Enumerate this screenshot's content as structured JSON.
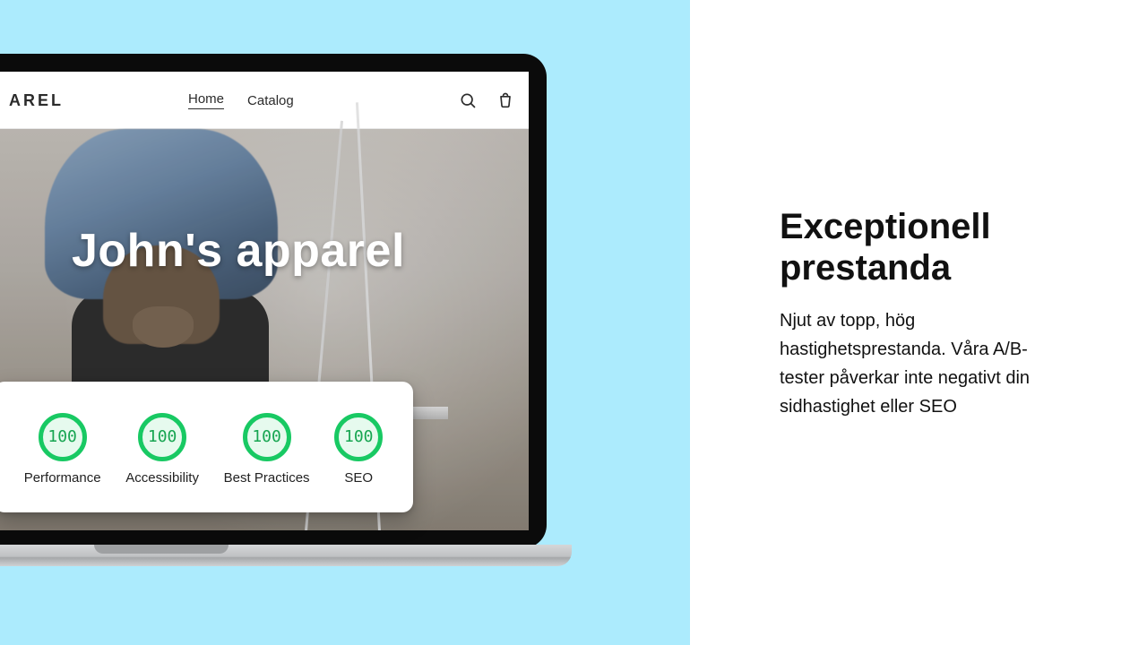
{
  "site": {
    "brand_fragment": "AREL",
    "nav": {
      "home": "Home",
      "catalog": "Catalog"
    },
    "hero_title": "John's apparel"
  },
  "scores": [
    {
      "value": "100",
      "label": "Performance"
    },
    {
      "value": "100",
      "label": "Accessibility"
    },
    {
      "value": "100",
      "label": "Best Practices"
    },
    {
      "value": "100",
      "label": "SEO"
    }
  ],
  "promo": {
    "heading": "Exceptionell prestanda",
    "body": "Njut av topp, hög hastighetsprestanda. Våra A/B-tester påverkar inte negativt din sidhastighet eller SEO"
  }
}
